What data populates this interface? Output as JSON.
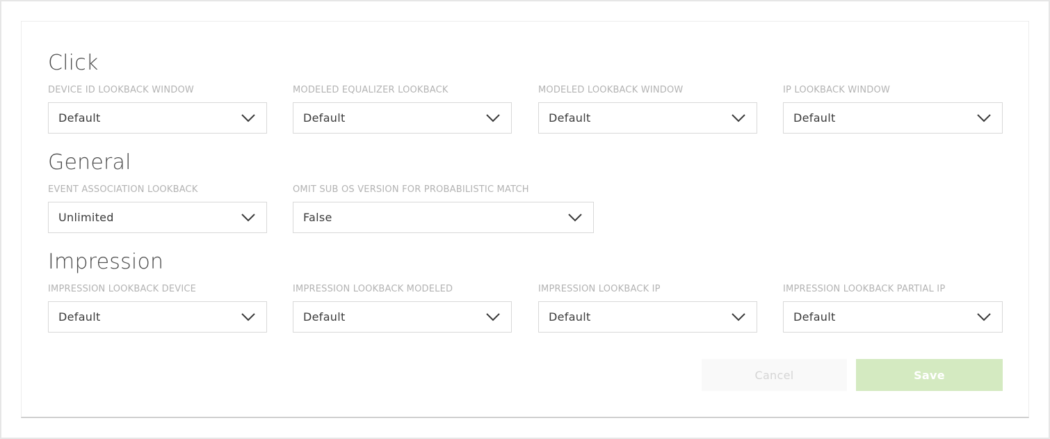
{
  "sections": {
    "click": {
      "title": "Click",
      "fields": [
        {
          "label": "DEVICE ID LOOKBACK WINDOW",
          "value": "Default"
        },
        {
          "label": "MODELED EQUALIZER LOOKBACK",
          "value": "Default"
        },
        {
          "label": "MODELED LOOKBACK WINDOW",
          "value": "Default"
        },
        {
          "label": "IP LOOKBACK WINDOW",
          "value": "Default"
        }
      ]
    },
    "general": {
      "title": "General",
      "fields": [
        {
          "label": "EVENT ASSOCIATION LOOKBACK",
          "value": "Unlimited"
        },
        {
          "label": "OMIT SUB OS VERSION FOR PROBABILISTIC MATCH",
          "value": "False"
        }
      ]
    },
    "impression": {
      "title": "Impression",
      "fields": [
        {
          "label": "IMPRESSION LOOKBACK DEVICE",
          "value": "Default"
        },
        {
          "label": "IMPRESSION LOOKBACK MODELED",
          "value": "Default"
        },
        {
          "label": "IMPRESSION LOOKBACK IP",
          "value": "Default"
        },
        {
          "label": "IMPRESSION LOOKBACK PARTIAL IP",
          "value": "Default"
        }
      ]
    }
  },
  "actions": {
    "cancel_label": "Cancel",
    "save_label": "Save"
  },
  "icons": {
    "dropdown": "chevron-down-icon"
  },
  "colors": {
    "save_button_bg": "#d4eac1",
    "cancel_button_bg": "#f9f9f9",
    "label_text": "#b3b3b3",
    "value_text": "#3a3a3a"
  }
}
